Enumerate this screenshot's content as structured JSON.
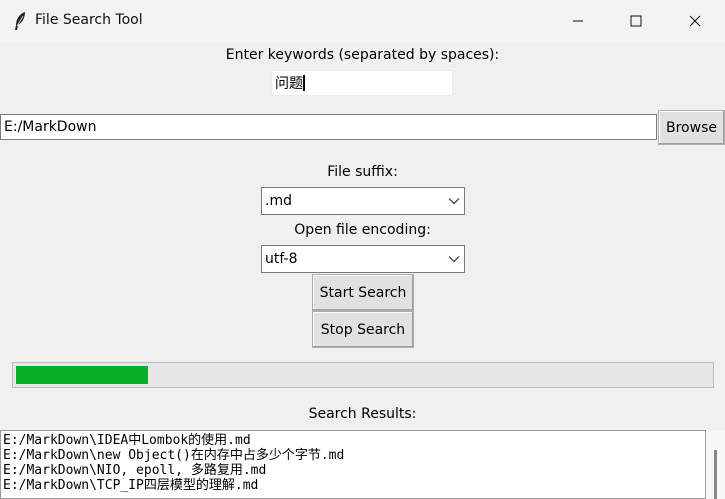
{
  "window": {
    "title": "File Search Tool",
    "icon": "feather-icon",
    "controls": [
      "minimize-icon",
      "maximize-icon",
      "close-icon"
    ]
  },
  "keywords": {
    "label": "Enter keywords (separated by spaces):",
    "value": "问题"
  },
  "path": {
    "value": "E:/MarkDown",
    "browse_label": "Browse"
  },
  "suffix": {
    "label": "File suffix:",
    "selected": ".md"
  },
  "encoding": {
    "label": "Open file encoding:",
    "selected": "utf-8"
  },
  "actions": {
    "start_label": "Start Search",
    "stop_label": "Stop Search"
  },
  "progress": {
    "fraction": 0.19,
    "color": "#06b025"
  },
  "results": {
    "label": "Search Results:",
    "lines": [
      "E:/MarkDown\\IDEA中Lombok的使用.md",
      "E:/MarkDown\\new Object()在内存中占多少个字节.md",
      "E:/MarkDown\\NIO, epoll, 多路复用.md",
      "E:/MarkDown\\TCP_IP四层模型的理解.md"
    ]
  }
}
